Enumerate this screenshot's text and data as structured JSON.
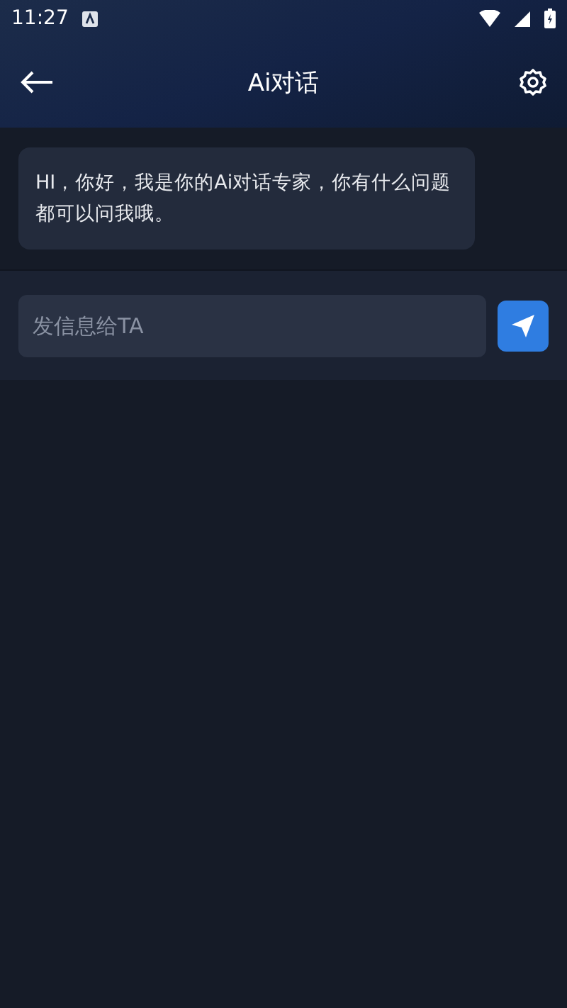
{
  "status_bar": {
    "time": "11:27"
  },
  "header": {
    "title": "Ai对话"
  },
  "messages": [
    {
      "kind": "bot",
      "text": "HI，你好，我是你的Ai对话专家，你有什么问题都可以问我哦。"
    }
  ],
  "composer": {
    "placeholder": "发信息给TA"
  }
}
